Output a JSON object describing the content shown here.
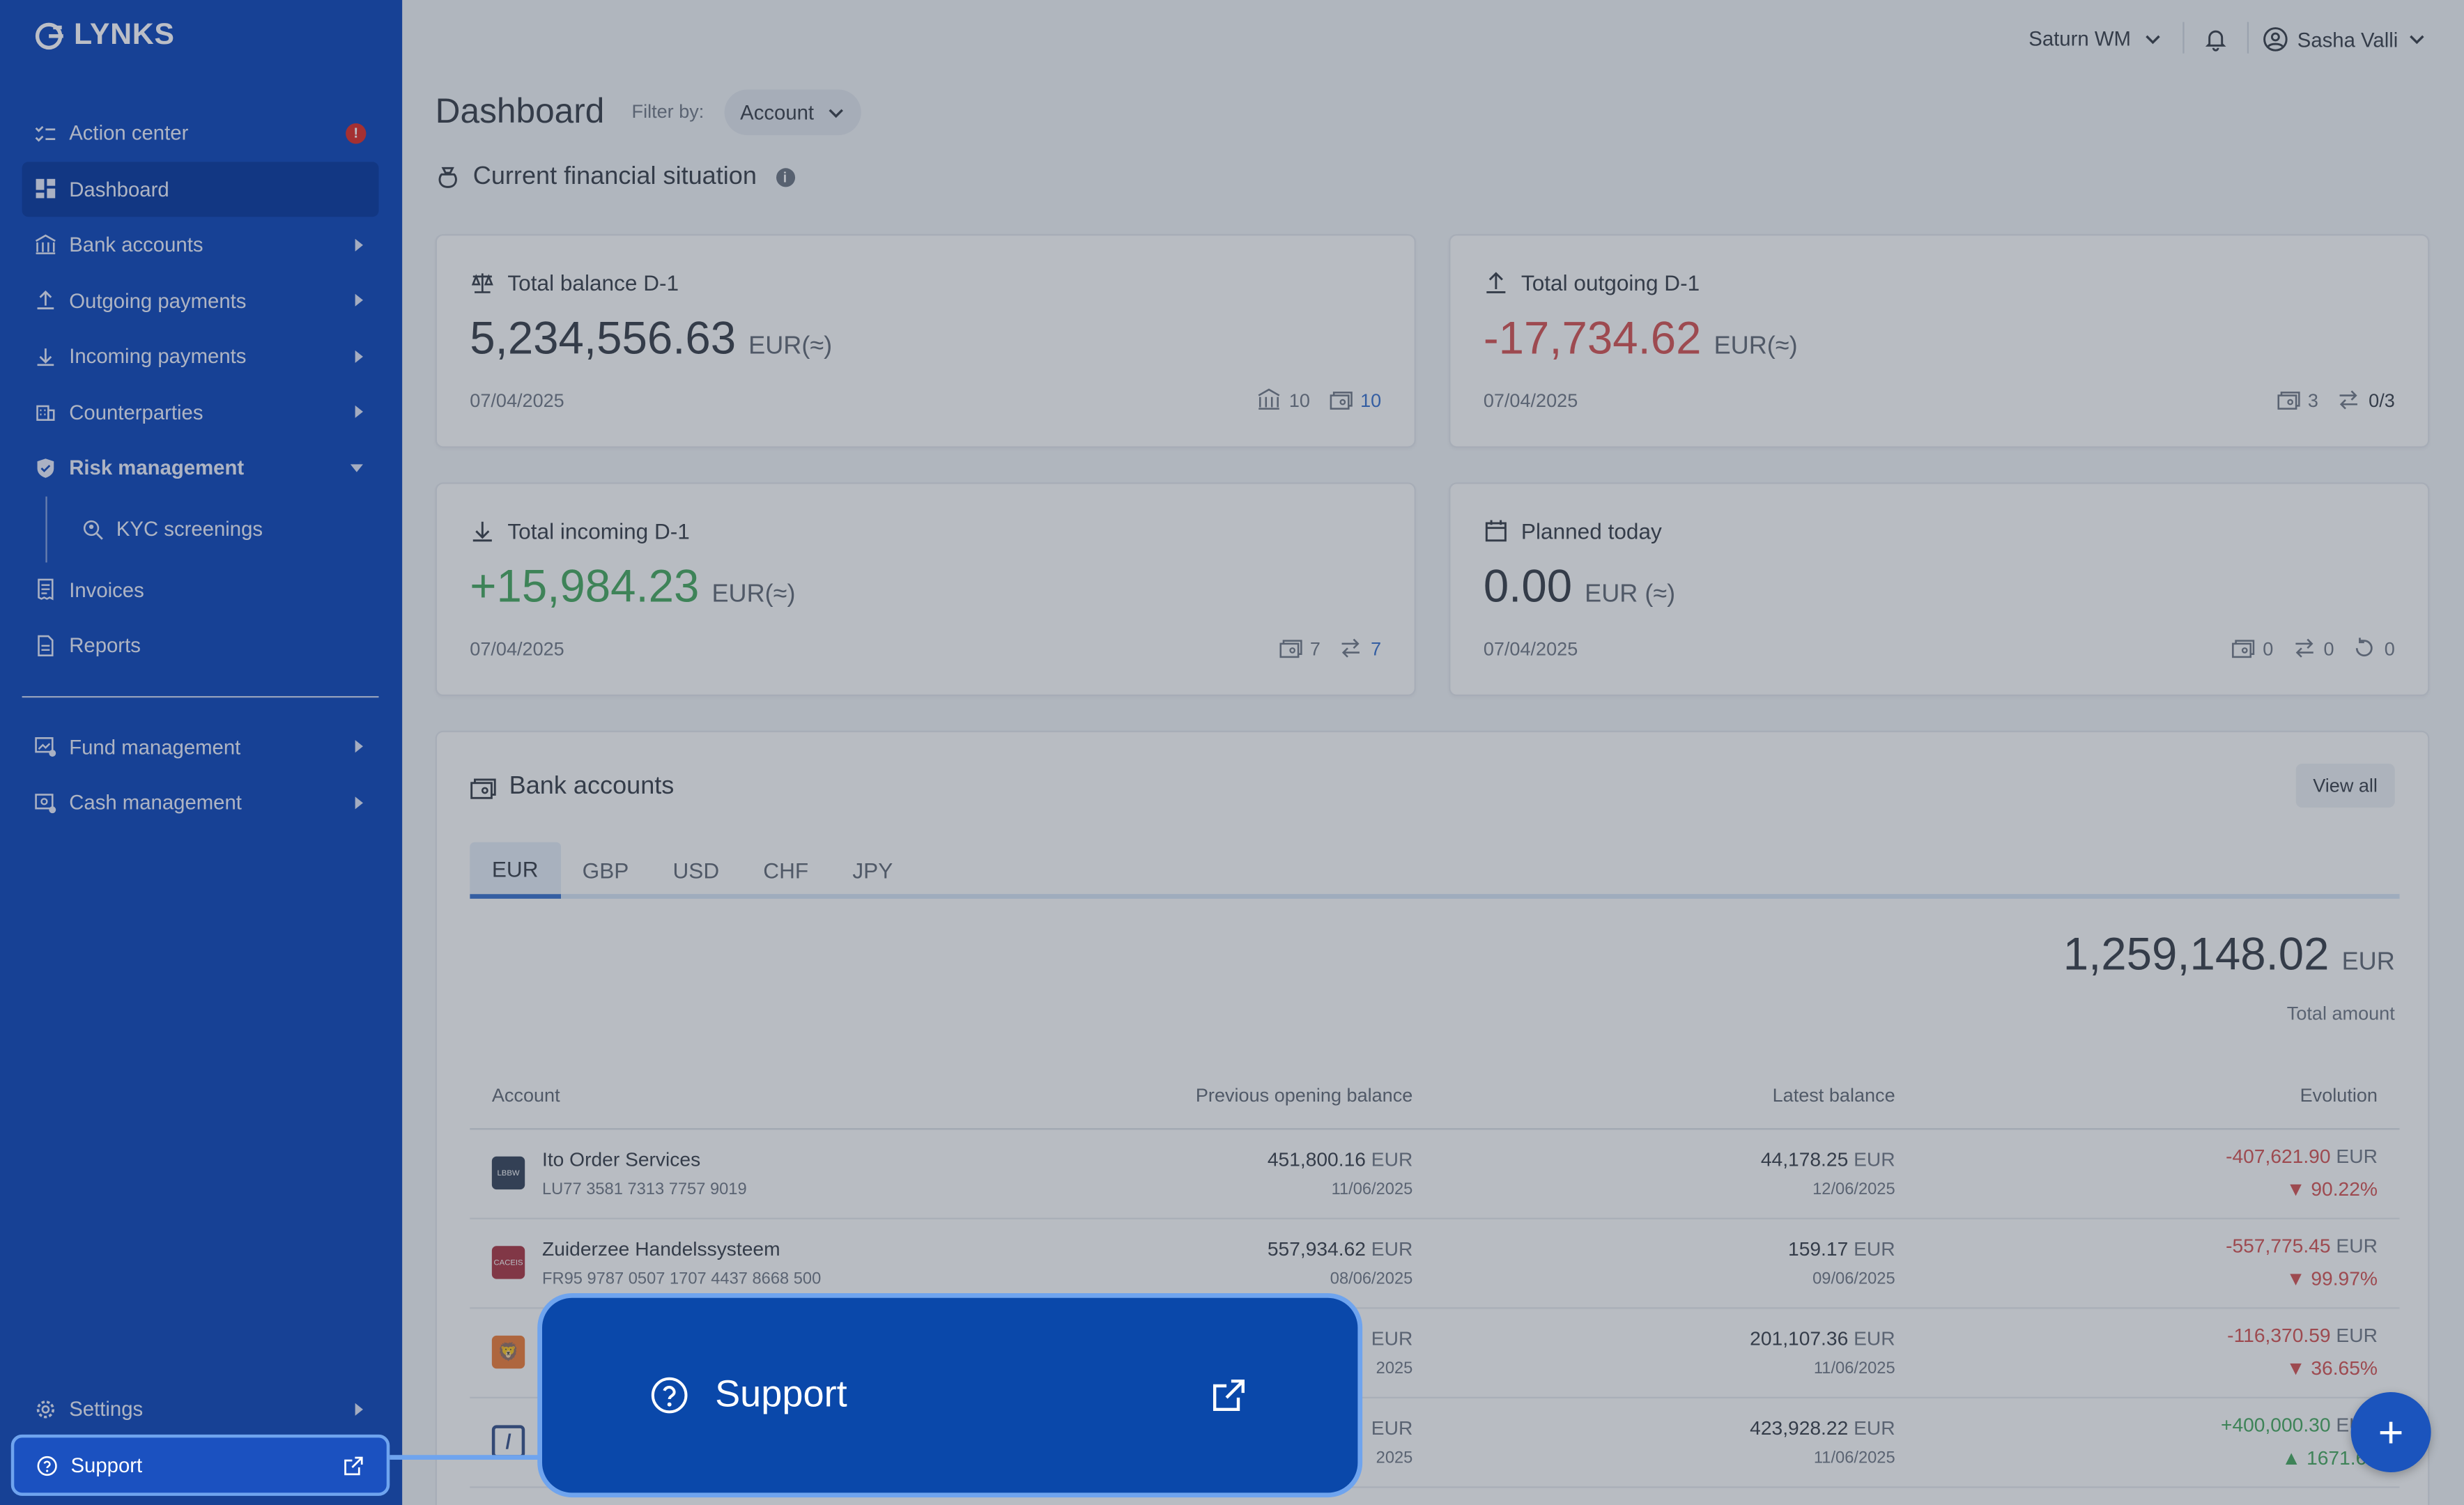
{
  "app": {
    "logo_text": "LYNKS"
  },
  "sidebar": {
    "items": [
      {
        "label": "Action center",
        "icon": "checklist-icon",
        "alert": "!"
      },
      {
        "label": "Dashboard",
        "icon": "dashboard-icon",
        "active": true
      },
      {
        "label": "Bank accounts",
        "icon": "bank-icon",
        "expandable": true
      },
      {
        "label": "Outgoing payments",
        "icon": "upload-icon",
        "expandable": true
      },
      {
        "label": "Incoming payments",
        "icon": "download-icon",
        "expandable": true
      },
      {
        "label": "Counterparties",
        "icon": "building-icon",
        "expandable": true
      },
      {
        "label": "Risk management",
        "icon": "shield-icon",
        "expanded": true
      },
      {
        "label": "KYC screenings",
        "icon": "search-person-icon",
        "sub": true
      },
      {
        "label": "Invoices",
        "icon": "receipt-icon"
      },
      {
        "label": "Reports",
        "icon": "document-icon"
      },
      {
        "label": "Fund management",
        "icon": "fund-icon",
        "expandable": true
      },
      {
        "label": "Cash management",
        "icon": "cash-icon",
        "expandable": true
      }
    ],
    "settings_label": "Settings",
    "support_label": "Support"
  },
  "topbar": {
    "company": "Saturn WM",
    "user": "Sasha Valli"
  },
  "header": {
    "title": "Dashboard",
    "filter_label": "Filter by:",
    "filter_value": "Account"
  },
  "financial": {
    "section_title": "Current financial situation",
    "cards": [
      {
        "label": "Total balance D-1",
        "value": "5,234,556.63",
        "unit": "EUR(≈)",
        "date": "07/04/2025",
        "meta": [
          {
            "icon": "bank-icon",
            "value": "10"
          },
          {
            "icon": "wallet-icon",
            "value": "10"
          }
        ]
      },
      {
        "label": "Total outgoing D-1",
        "value": "-17,734.62",
        "unit": "EUR(≈)",
        "date": "07/04/2025",
        "meta": [
          {
            "icon": "wallet-icon",
            "value": "3"
          },
          {
            "icon": "transfer-icon",
            "value": "0/3"
          }
        ]
      },
      {
        "label": "Total incoming D-1",
        "value": "+15,984.23",
        "unit": "EUR(≈)",
        "date": "07/04/2025",
        "meta": [
          {
            "icon": "wallet-icon",
            "value": "7"
          },
          {
            "icon": "transfer-icon",
            "value": "7"
          }
        ]
      },
      {
        "label": "Planned today",
        "value": "0.00",
        "unit": "EUR (≈)",
        "date": "07/04/2025",
        "meta": [
          {
            "icon": "wallet-icon",
            "value": "0"
          },
          {
            "icon": "transfer-icon",
            "value": "0"
          },
          {
            "icon": "refresh-icon",
            "value": "0"
          }
        ]
      }
    ]
  },
  "bank_accounts": {
    "title": "Bank accounts",
    "view_all": "View all",
    "tabs": [
      "EUR",
      "GBP",
      "USD",
      "CHF",
      "JPY"
    ],
    "active_tab": "EUR",
    "total_value": "1,259,148.02",
    "total_unit": "EUR",
    "total_label": "Total amount",
    "columns": [
      "Account",
      "Previous opening balance",
      "Latest balance",
      "Evolution"
    ],
    "rows": [
      {
        "name": "Ito Order Services",
        "iban": "LU77 3581 7313 7757 9019",
        "prev": "451,800.16",
        "prev_unit": "EUR",
        "prev_date": "11/06/2025",
        "latest": "44,178.25",
        "latest_unit": "EUR",
        "latest_date": "12/06/2025",
        "evo": "-407,621.90",
        "evo_unit": "EUR",
        "evo_pct": "90.22%",
        "logo_color": "#1b2a44",
        "logo_text": "LBBW"
      },
      {
        "name": "Zuiderzee Handelssysteem",
        "iban": "FR95 9787 0507 1707 4437 8668 500",
        "prev": "557,934.62",
        "prev_unit": "EUR",
        "prev_date": "08/06/2025",
        "latest": "159.17",
        "latest_unit": "EUR",
        "latest_date": "09/06/2025",
        "evo": "-557,775.45",
        "evo_unit": "EUR",
        "evo_pct": "99.97%",
        "logo_color": "#a01a2a",
        "logo_text": "CACEIS"
      },
      {
        "name": "",
        "iban": "",
        "prev": "",
        "prev_unit": "EUR",
        "prev_date": "2025",
        "latest": "201,107.36",
        "latest_unit": "EUR",
        "latest_date": "11/06/2025",
        "evo": "-116,370.59",
        "evo_unit": "EUR",
        "evo_pct": "36.65%",
        "logo_color": "#ee6b1c",
        "logo_text": ""
      },
      {
        "name": "",
        "iban": "",
        "prev": "",
        "prev_unit": "EUR",
        "prev_date": "2025",
        "latest": "423,928.22",
        "latest_unit": "EUR",
        "latest_date": "11/06/2025",
        "evo": "+400,000.30",
        "evo_unit": "EUR",
        "evo_pct": "1671.69",
        "logo_color": "#1b3a7a",
        "logo_text": ""
      }
    ]
  },
  "support_popup": {
    "label": "Support"
  },
  "fab": {
    "label": "+"
  }
}
